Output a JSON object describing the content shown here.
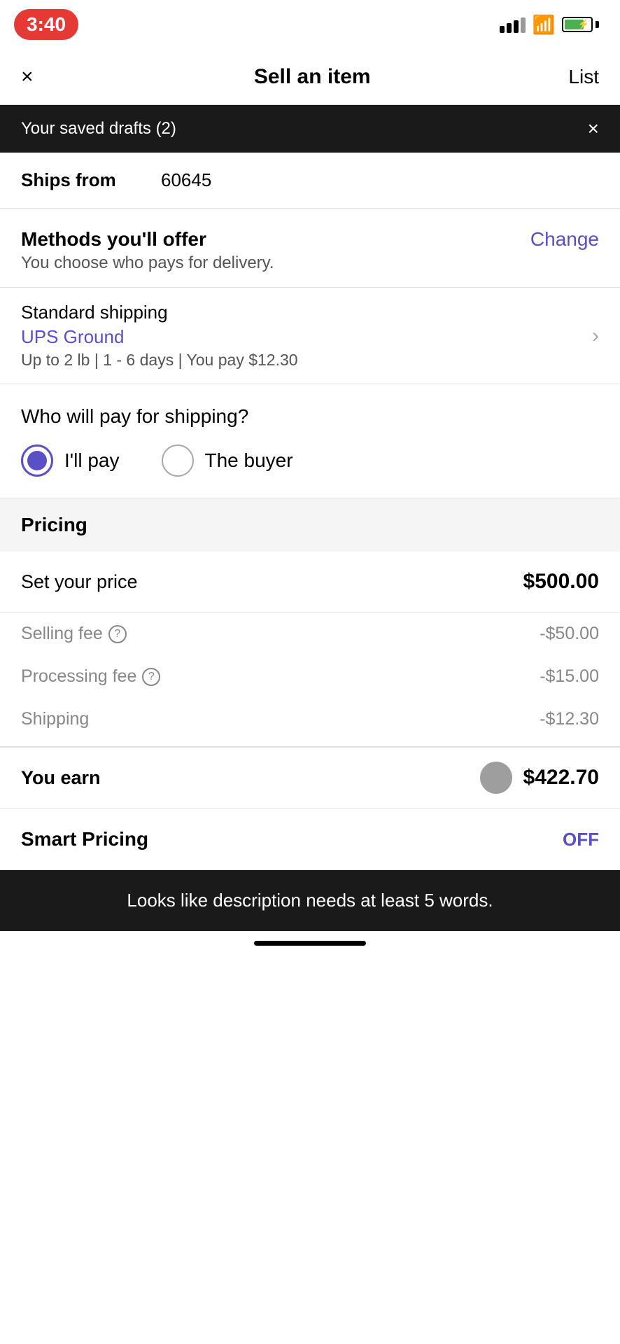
{
  "statusBar": {
    "time": "3:40",
    "batteryPercent": 75
  },
  "navBar": {
    "closeLabel": "×",
    "title": "Sell an item",
    "listLabel": "List"
  },
  "banner": {
    "text": "Your saved drafts (2)",
    "closeLabel": "×"
  },
  "shipsFrom": {
    "label": "Ships from",
    "value": "60645"
  },
  "methods": {
    "sectionTitle": "Methods you'll offer",
    "sectionSubtitle": "You choose who pays for delivery.",
    "changeLabel": "Change",
    "shipping": {
      "title": "Standard shipping",
      "carrier": "UPS Ground",
      "details": "Up to 2 lb | 1 - 6 days | You pay $12.30"
    }
  },
  "whoPayShipping": {
    "question": "Who will pay for shipping?",
    "option1": "I'll pay",
    "option2": "The buyer"
  },
  "pricing": {
    "sectionTitle": "Pricing",
    "setPriceLabel": "Set your price",
    "setPriceValue": "$500.00",
    "sellingFeeLabel": "Selling fee",
    "sellingFeeValue": "-$50.00",
    "processingFeeLabel": "Processing fee",
    "processingFeeValue": "-$15.00",
    "shippingLabel": "Shipping",
    "shippingValue": "-$12.30",
    "youEarnLabel": "You earn",
    "youEarnValue": "$422.70"
  },
  "smartPricing": {
    "label": "Smart Pricing",
    "toggleLabel": "OFF"
  },
  "toast": {
    "message": "Looks like description needs at least 5 words."
  },
  "colors": {
    "accent": "#5b4fc7",
    "selectedRadio": "#5b4fc7"
  }
}
